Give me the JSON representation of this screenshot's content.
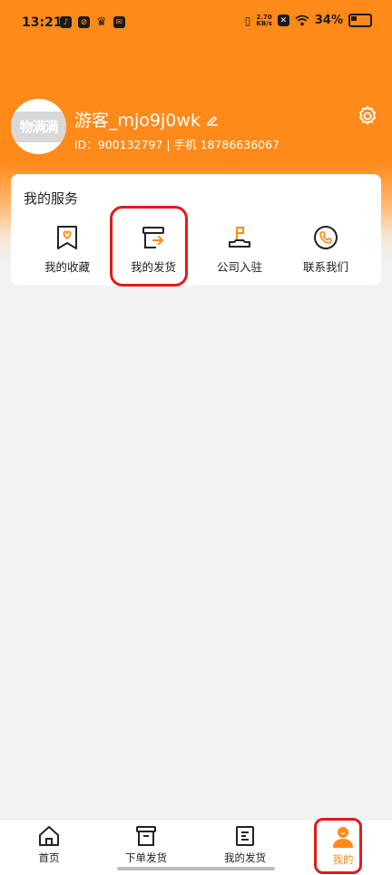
{
  "status_bar": {
    "time": "13:21",
    "speed_value": "2.70",
    "speed_unit": "KB/s",
    "battery": "34%"
  },
  "profile": {
    "avatar_text": "物满满",
    "username": "游客_mjo9j0wk",
    "info": "ID：900132797 | 手机 18786636067"
  },
  "services": {
    "title": "我的服务",
    "items": [
      {
        "label": "我的收藏",
        "icon": "bookmark-heart-icon"
      },
      {
        "label": "我的发货",
        "icon": "box-arrow-icon"
      },
      {
        "label": "公司入驻",
        "icon": "flag-checkin-icon"
      },
      {
        "label": "联系我们",
        "icon": "phone-icon"
      }
    ]
  },
  "tabbar": {
    "items": [
      {
        "label": "首页",
        "icon": "home-icon"
      },
      {
        "label": "下单发货",
        "icon": "order-box-icon"
      },
      {
        "label": "我的发货",
        "icon": "list-icon"
      },
      {
        "label": "我的",
        "icon": "person-icon",
        "active": true
      }
    ]
  },
  "colors": {
    "accent": "#ff8a1a",
    "highlight": "#e01b1b"
  }
}
